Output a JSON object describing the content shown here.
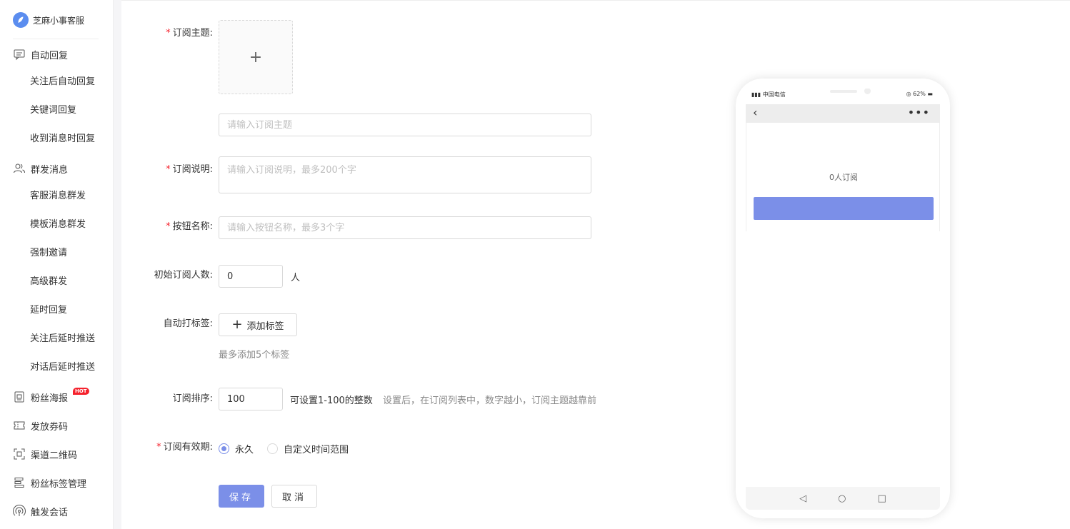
{
  "brand": {
    "name": "芝麻小事客服"
  },
  "sidebar": {
    "groups": [
      {
        "label": "自动回复",
        "icon": "chat-icon",
        "items": [
          "关注后自动回复",
          "关键词回复",
          "收到消息时回复"
        ]
      },
      {
        "label": "群发消息",
        "icon": "users-icon",
        "items": [
          "客服消息群发",
          "模板消息群发",
          "强制邀请",
          "高级群发",
          "延时回复",
          "关注后延时推送",
          "对话后延时推送"
        ]
      },
      {
        "label": "粉丝海报",
        "icon": "poster-icon",
        "badge": "HOT"
      },
      {
        "label": "发放券码",
        "icon": "ticket-icon"
      },
      {
        "label": "渠道二维码",
        "icon": "qrcode-icon"
      },
      {
        "label": "粉丝标签管理",
        "icon": "tag-list-icon"
      },
      {
        "label": "触发会话",
        "icon": "signal-icon"
      }
    ]
  },
  "form": {
    "topic_label": "订阅主题",
    "topic_placeholder": "请输入订阅主题",
    "desc_label": "订阅说明",
    "desc_placeholder": "请输入订阅说明，最多200个字",
    "button_label": "按钮名称",
    "button_placeholder": "请输入按钮名称，最多3个字",
    "initial_label": "初始订阅人数",
    "initial_value": "0",
    "initial_unit": "人",
    "autotag_label": "自动打标签",
    "add_tag_button": "添加标签",
    "tag_hint": "最多添加5个标签",
    "order_label": "订阅排序",
    "order_value": "100",
    "order_hint1": "可设置1-100的整数",
    "order_hint2": "设置后，在订阅列表中，数字越小，订阅主题越靠前",
    "validity_label": "订阅有效期",
    "validity_options": [
      "永久",
      "自定义时间范围"
    ],
    "validity_selected": "永久",
    "save_button": "保存",
    "cancel_button": "取消"
  },
  "preview": {
    "carrier": "中国电信",
    "battery": "62%",
    "subscriber_text": "0人订阅",
    "accent_color": "#7b8fe8"
  }
}
